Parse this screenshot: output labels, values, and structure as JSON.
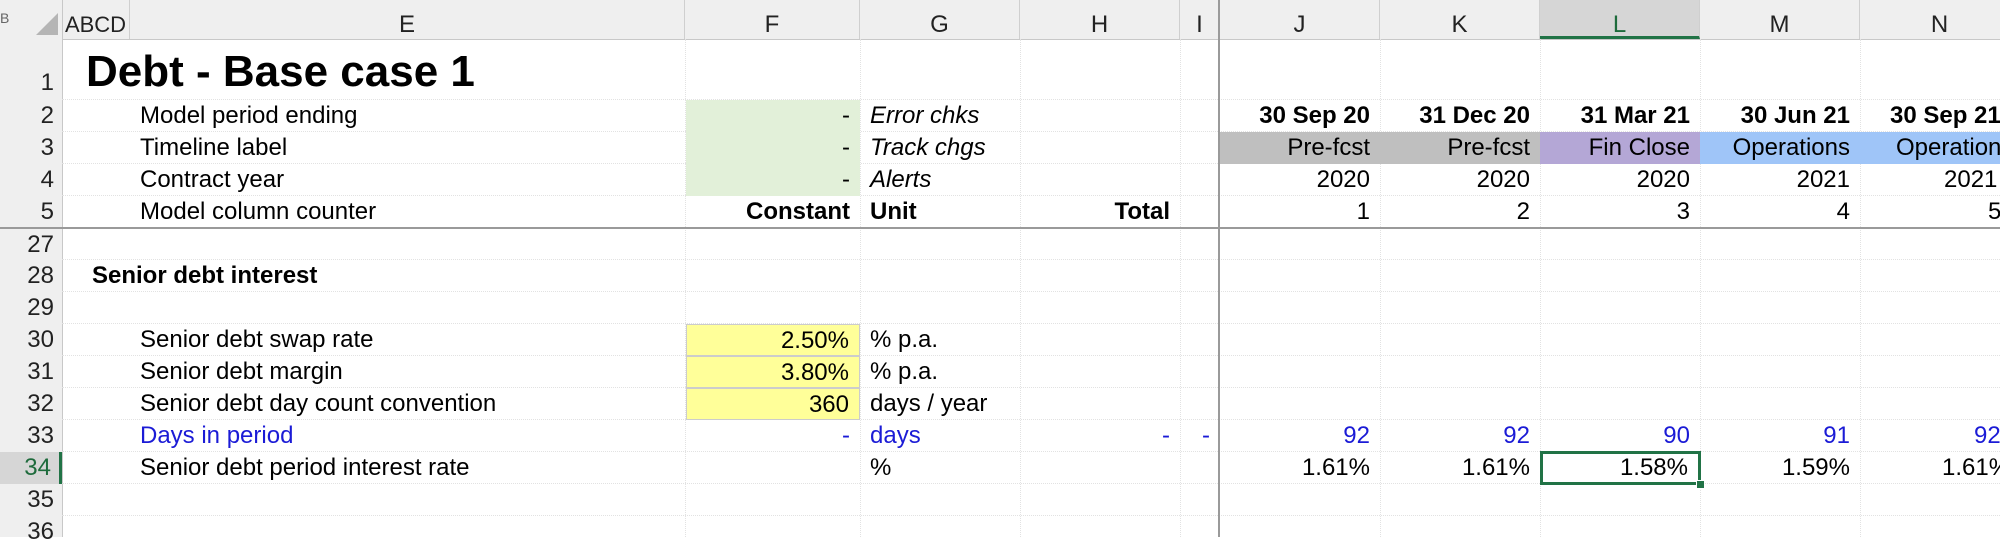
{
  "columns": {
    "corner_mark": "B",
    "abcd": "ABCD",
    "E": "E",
    "F": "F",
    "G": "G",
    "H": "H",
    "I": "I",
    "J": "J",
    "K": "K",
    "L": "L",
    "M": "M",
    "N": "N"
  },
  "rows": [
    "1",
    "2",
    "3",
    "4",
    "5",
    "27",
    "28",
    "29",
    "30",
    "31",
    "32",
    "33",
    "34",
    "35",
    "36"
  ],
  "title": "Debt - Base case 1",
  "header_rows": {
    "model_period_ending": {
      "label": "Model period ending",
      "F": "-",
      "G": "Error chks"
    },
    "timeline_label": {
      "label": "Timeline label",
      "F": "-",
      "G": "Track chgs"
    },
    "contract_year": {
      "label": "Contract year",
      "F": "-",
      "G": "Alerts"
    },
    "model_column_counter": {
      "label": "Model column counter",
      "F": "Constant",
      "G": "Unit",
      "H": "Total"
    }
  },
  "periods": [
    {
      "date": "30 Sep 20",
      "phase": "Pre-fcst",
      "year": "2020",
      "counter": "1",
      "days": "92",
      "rate": "1.61%"
    },
    {
      "date": "31 Dec 20",
      "phase": "Pre-fcst",
      "year": "2020",
      "counter": "2",
      "days": "92",
      "rate": "1.61%"
    },
    {
      "date": "31 Mar 21",
      "phase": "Fin Close",
      "year": "2020",
      "counter": "3",
      "days": "90",
      "rate": "1.58%"
    },
    {
      "date": "30 Jun 21",
      "phase": "Operations",
      "year": "2021",
      "counter": "4",
      "days": "91",
      "rate": "1.59%"
    },
    {
      "date": "30 Sep 21",
      "phase": "Operations",
      "year": "2021",
      "counter": "5",
      "days": "92",
      "rate": "1.61%"
    }
  ],
  "section": {
    "heading": "Senior debt interest"
  },
  "inputs": {
    "swap_rate": {
      "label": "Senior debt swap rate",
      "value": "2.50%",
      "unit": "% p.a."
    },
    "margin": {
      "label": "Senior debt margin",
      "value": "3.80%",
      "unit": "% p.a."
    },
    "day_count": {
      "label": "Senior debt day count convention",
      "value": "360",
      "unit": "days / year"
    }
  },
  "calcs": {
    "days_in_period": {
      "label": "Days in period",
      "F": "-",
      "unit": "days",
      "H": "-",
      "I": "-"
    },
    "period_rate": {
      "label": "Senior debt period interest rate",
      "unit": "%"
    }
  },
  "colors": {
    "accent": "#217346",
    "input_fill": "#ffff99",
    "header_fill": "#e2f0d9",
    "link_blue": "#1b1bd6"
  }
}
